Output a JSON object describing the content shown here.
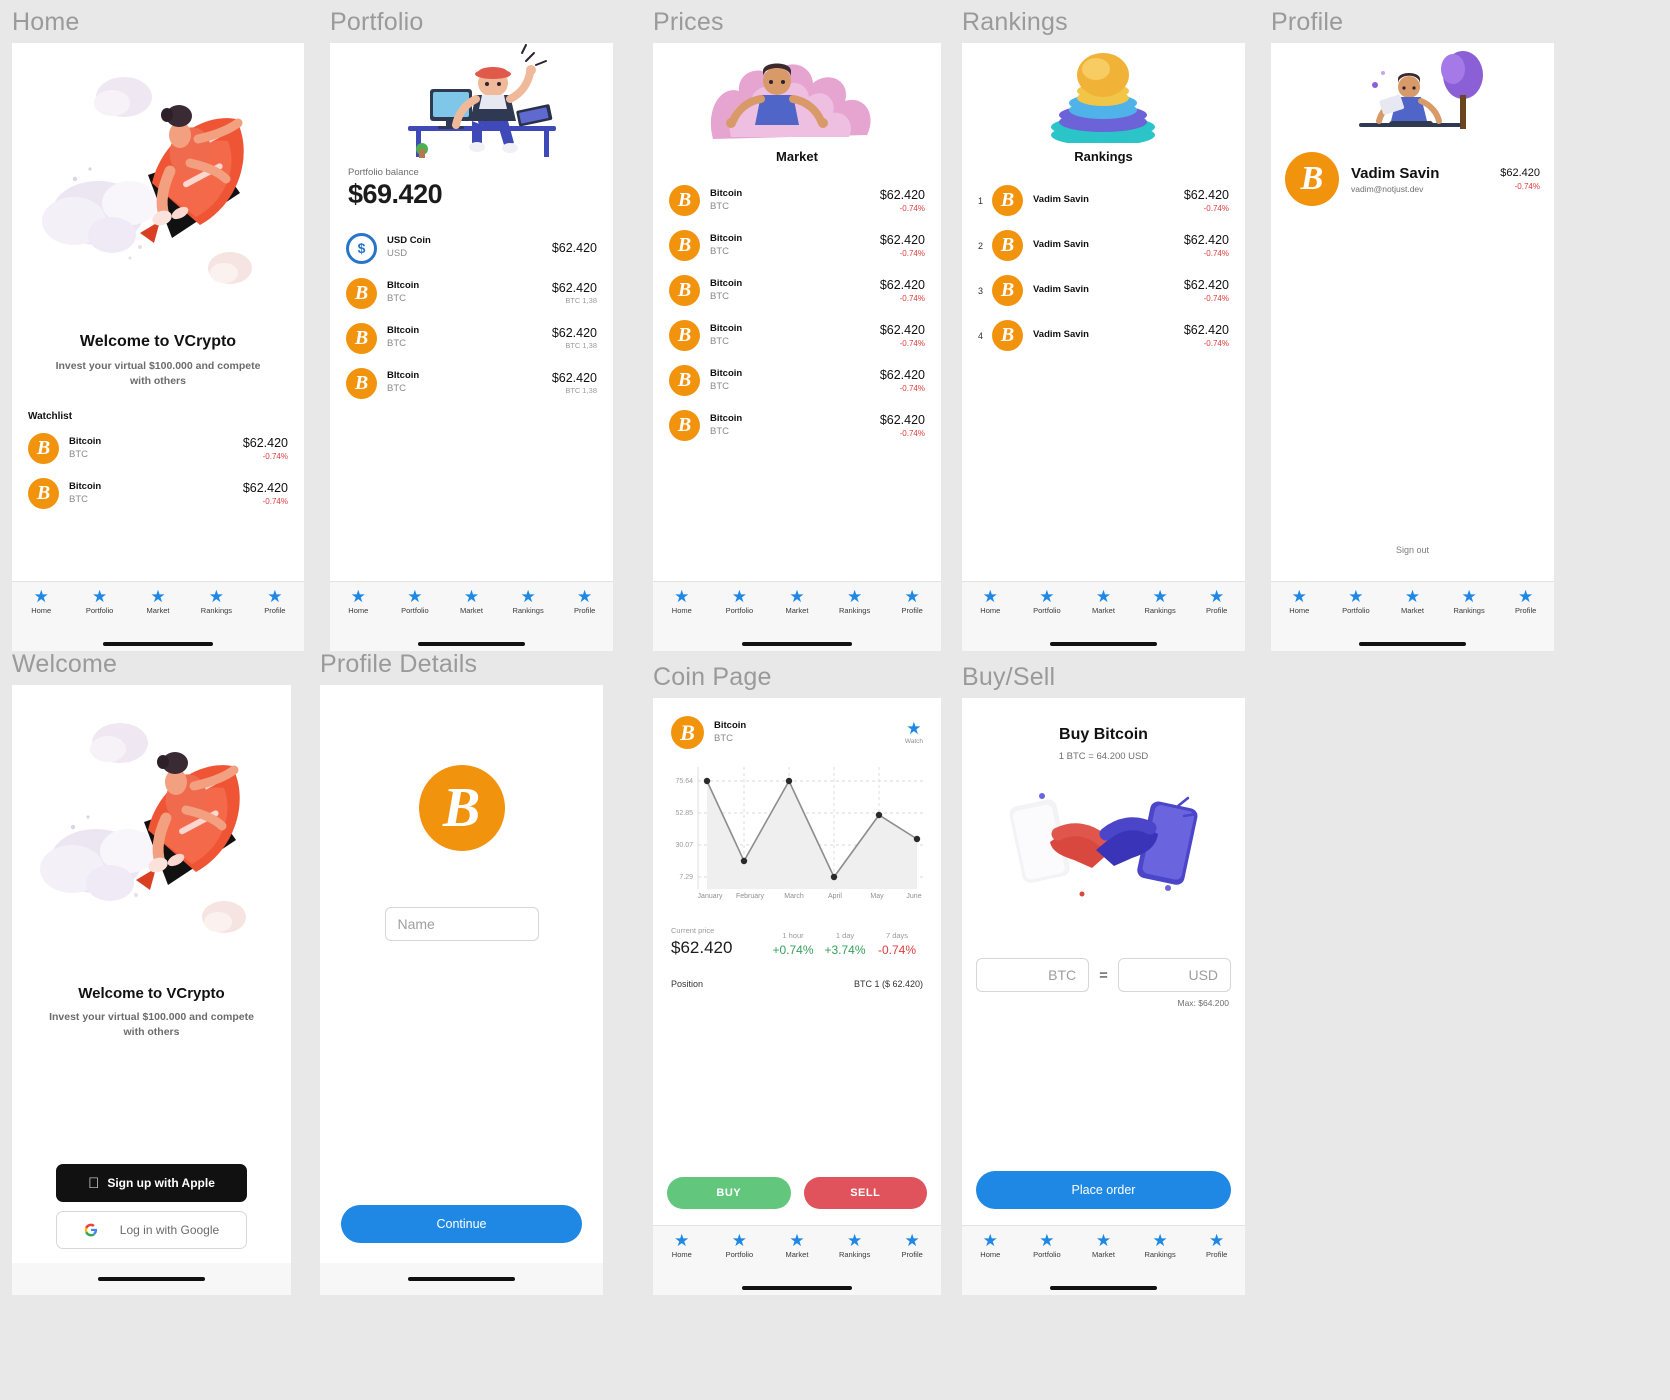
{
  "frames": {
    "home": "Home",
    "portfolio": "Portfolio",
    "prices": "Prices",
    "rankings": "Rankings",
    "profile": "Profile",
    "welcome": "Welcome",
    "profile_details": "Profile Details",
    "coin_page": "Coin Page",
    "buy_sell": "Buy/Sell"
  },
  "tabbar": {
    "items": [
      {
        "label": "Home",
        "icon": "star-icon"
      },
      {
        "label": "Portfolio",
        "icon": "star-icon"
      },
      {
        "label": "Market",
        "icon": "star-icon"
      },
      {
        "label": "Rankings",
        "icon": "star-icon"
      },
      {
        "label": "Profile",
        "icon": "star-icon"
      }
    ]
  },
  "home": {
    "title": "Welcome to VCrypto",
    "subtitle": "Invest your virtual $100.000 and compete with others",
    "watchlist_label": "Watchlist",
    "watchlist": [
      {
        "name": "Bitcoin",
        "symbol": "BTC",
        "price": "$62.420",
        "change": "-0.74%"
      },
      {
        "name": "Bitcoin",
        "symbol": "BTC",
        "price": "$62.420",
        "change": "-0.74%"
      }
    ]
  },
  "portfolio": {
    "balance_label": "Portfolio balance",
    "balance": "$69.420",
    "holdings": [
      {
        "name": "USD Coin",
        "symbol": "USD",
        "price": "$62.420",
        "sub": "",
        "icon": "usdc-icon"
      },
      {
        "name": "BItcoin",
        "symbol": "BTC",
        "price": "$62.420",
        "sub": "BTC 1,38",
        "icon": "bitcoin-icon"
      },
      {
        "name": "BItcoin",
        "symbol": "BTC",
        "price": "$62.420",
        "sub": "BTC 1,38",
        "icon": "bitcoin-icon"
      },
      {
        "name": "BItcoin",
        "symbol": "BTC",
        "price": "$62.420",
        "sub": "BTC 1,38",
        "icon": "bitcoin-icon"
      }
    ]
  },
  "prices": {
    "heading": "Market",
    "rows": [
      {
        "name": "Bitcoin",
        "symbol": "BTC",
        "price": "$62.420",
        "change": "-0.74%"
      },
      {
        "name": "Bitcoin",
        "symbol": "BTC",
        "price": "$62.420",
        "change": "-0.74%"
      },
      {
        "name": "Bitcoin",
        "symbol": "BTC",
        "price": "$62.420",
        "change": "-0.74%"
      },
      {
        "name": "Bitcoin",
        "symbol": "BTC",
        "price": "$62.420",
        "change": "-0.74%"
      },
      {
        "name": "Bitcoin",
        "symbol": "BTC",
        "price": "$62.420",
        "change": "-0.74%"
      },
      {
        "name": "Bitcoin",
        "symbol": "BTC",
        "price": "$62.420",
        "change": "-0.74%"
      }
    ]
  },
  "rankings": {
    "heading": "Rankings",
    "rows": [
      {
        "rank": "1",
        "name": "Vadim Savin",
        "price": "$62.420",
        "change": "-0.74%"
      },
      {
        "rank": "2",
        "name": "Vadim Savin",
        "price": "$62.420",
        "change": "-0.74%"
      },
      {
        "rank": "3",
        "name": "Vadim Savin",
        "price": "$62.420",
        "change": "-0.74%"
      },
      {
        "rank": "4",
        "name": "Vadim Savin",
        "price": "$62.420",
        "change": "-0.74%"
      }
    ]
  },
  "profile": {
    "name": "Vadim Savin",
    "email": "vadim@notjust.dev",
    "price": "$62.420",
    "change": "-0.74%",
    "sign_out": "Sign out"
  },
  "welcome": {
    "title": "Welcome to VCrypto",
    "subtitle": "Invest your virtual $100.000 and compete with others",
    "apple_button": "Sign up with Apple",
    "google_button": "Log in with Google"
  },
  "profile_details": {
    "name_placeholder": "Name",
    "name_value": "",
    "continue_button": "Continue"
  },
  "coin_page": {
    "coin_name": "Bitcoin",
    "coin_symbol": "BTC",
    "watch_label": "Watch",
    "current_price_label": "Current price",
    "current_price": "$62.420",
    "stats": [
      {
        "label": "1 hour",
        "value": "+0.74%",
        "dir": "up"
      },
      {
        "label": "1 day",
        "value": "+3.74%",
        "dir": "up"
      },
      {
        "label": "7 days",
        "value": "-0.74%",
        "dir": "down"
      }
    ],
    "position_label": "Position",
    "position_value": "BTC 1 ($ 62.420)",
    "buy_button": "BUY",
    "sell_button": "SELL"
  },
  "buy_sell": {
    "title": "Buy Bitcoin",
    "rate": "1 BTC = 64.200 USD",
    "btc_field_value": "",
    "btc_field_unit": "BTC",
    "equals": "=",
    "usd_field_value": "",
    "usd_field_unit": "USD",
    "max_label": "Max: $64.200",
    "place_order_button": "Place order"
  },
  "chart_data": {
    "type": "line",
    "title": "",
    "xlabel": "",
    "ylabel": "",
    "categories": [
      "January",
      "February",
      "March",
      "April",
      "May",
      "June"
    ],
    "values": [
      75.64,
      14.5,
      75.64,
      7.29,
      49.5,
      38.0
    ],
    "ytick_labels": [
      "75.64",
      "52.85",
      "30.07",
      "7.29"
    ],
    "ytick_values": [
      75.64,
      52.85,
      30.07,
      7.29
    ],
    "ylim": [
      7.29,
      75.64
    ],
    "grid": true,
    "legend": "none",
    "line_color": "#8d8d8d",
    "point_color": "#2a2a2a",
    "fill_color": "#f0f0f0"
  },
  "colors": {
    "accent": "#1f88e5",
    "bitcoin": "#f2930d",
    "usdc": "#2775ca",
    "up": "#37a05b",
    "down": "#e03b3b",
    "buy": "#63c67d",
    "sell": "#e0525c"
  }
}
